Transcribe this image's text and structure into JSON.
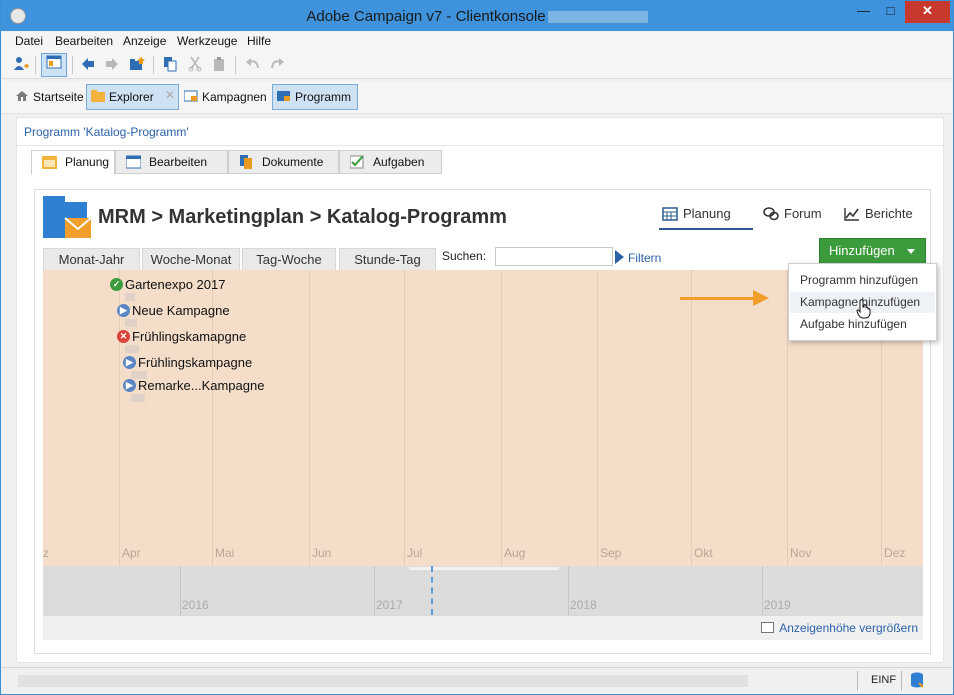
{
  "window": {
    "title": "Adobe Campaign v7 - Clientkonsole",
    "minimize_glyph": "—",
    "maximize_glyph": "□",
    "close_glyph": "✕"
  },
  "menu": [
    "Datei",
    "Bearbeiten",
    "Anzeige",
    "Werkzeuge",
    "Hilfe"
  ],
  "toolbar": {
    "icons": [
      "new-user-icon",
      "explorer-icon",
      "back-arrow-icon",
      "forward-arrow-icon",
      "folder-up-icon",
      "copy-icon",
      "cut-icon",
      "paste-icon",
      "undo-icon",
      "redo-icon"
    ]
  },
  "nav_tabs": {
    "home": "Startseite",
    "explorer": "Explorer",
    "close_glyph": "✕",
    "campaigns": "Kampagnen",
    "program": "Programm"
  },
  "breadcrumb": "Programm 'Katalog-Programm'",
  "page_tabs": [
    "Planung",
    "Bearbeiten",
    "Dokumente",
    "Aufgaben"
  ],
  "panel": {
    "title": "MRM > Marketingplan > Katalog-Programm",
    "sub_tabs": [
      "Planung",
      "Forum",
      "Berichte"
    ],
    "add_button": "Hinzufügen"
  },
  "view_tabs": [
    "Monat-Jahr",
    "Woche-Monat",
    "Tag-Woche",
    "Stunde-Tag"
  ],
  "search": {
    "label": "Suchen:",
    "value": "",
    "filter_label": "Filtern"
  },
  "timeline": {
    "months": [
      "z",
      "Apr",
      "Mai",
      "Jun",
      "Jul",
      "Aug",
      "Sep",
      "Okt",
      "Nov",
      "Dez"
    ],
    "items": [
      {
        "label": "Gartenexpo 2017",
        "status": "check"
      },
      {
        "label": "Neue Kampagne",
        "status": "play"
      },
      {
        "label": "Frühlingskamapgne",
        "status": "error"
      },
      {
        "label": "Frühlingskampagne",
        "status": "play"
      },
      {
        "label": "Remarke...Kampagne",
        "status": "play"
      }
    ],
    "status_glyphs": {
      "check": "✓",
      "play": "▶",
      "error": "✕"
    },
    "years": [
      "2016",
      "2017",
      "2018",
      "2019"
    ]
  },
  "enlarge_link": "Anzeigenhöhe vergrößern",
  "dropdown": {
    "items": [
      "Programm hinzufügen",
      "Kampagne hinzufügen",
      "Aufgabe hinzufügen"
    ],
    "hovered_index": 1
  },
  "statusbar": {
    "mode": "EINF"
  },
  "colors": {
    "title_bar": "#3e93dc",
    "close_button": "#c7382d",
    "timeline_bg": "#f4ddc9",
    "add_button": "#3c9b3c",
    "link": "#2b62a8",
    "annotation_arrow": "#f29e2a"
  }
}
